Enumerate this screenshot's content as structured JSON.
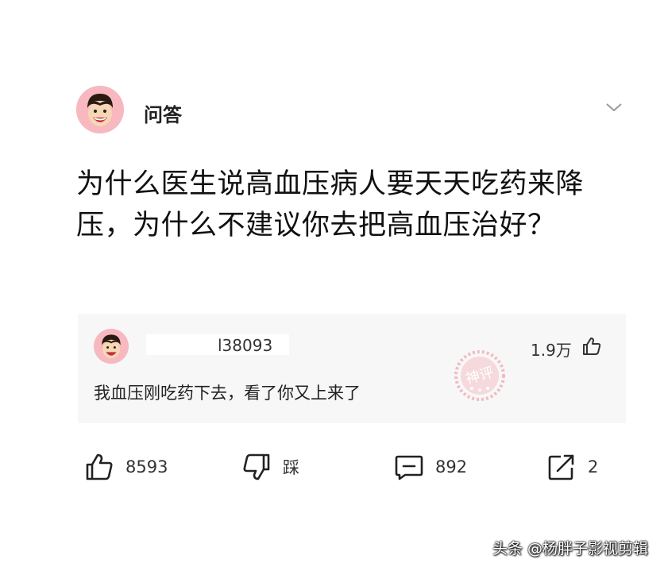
{
  "post": {
    "author": "问答",
    "question": "为什么医生说高血压病人要天天吃药来降压，为什么不建议你去把高血压治好？"
  },
  "comment": {
    "username": "l38093",
    "likes": "1.9万",
    "text": "我血压刚吃药下去，看了你又上来了",
    "stamp_text": "神评"
  },
  "actions": {
    "like_count": "8593",
    "dislike_label": "踩",
    "comment_count": "892",
    "share_count": "2"
  },
  "watermark": "头条 @杨胖子影视剪辑",
  "colors": {
    "avatar_bg": "#f7b8c0",
    "stamp": "#f08a95",
    "card_bg": "#f7f7f7"
  },
  "icons": [
    "chevron-down-icon",
    "thumbs-up-icon",
    "thumbs-down-icon",
    "comment-icon",
    "share-icon"
  ]
}
